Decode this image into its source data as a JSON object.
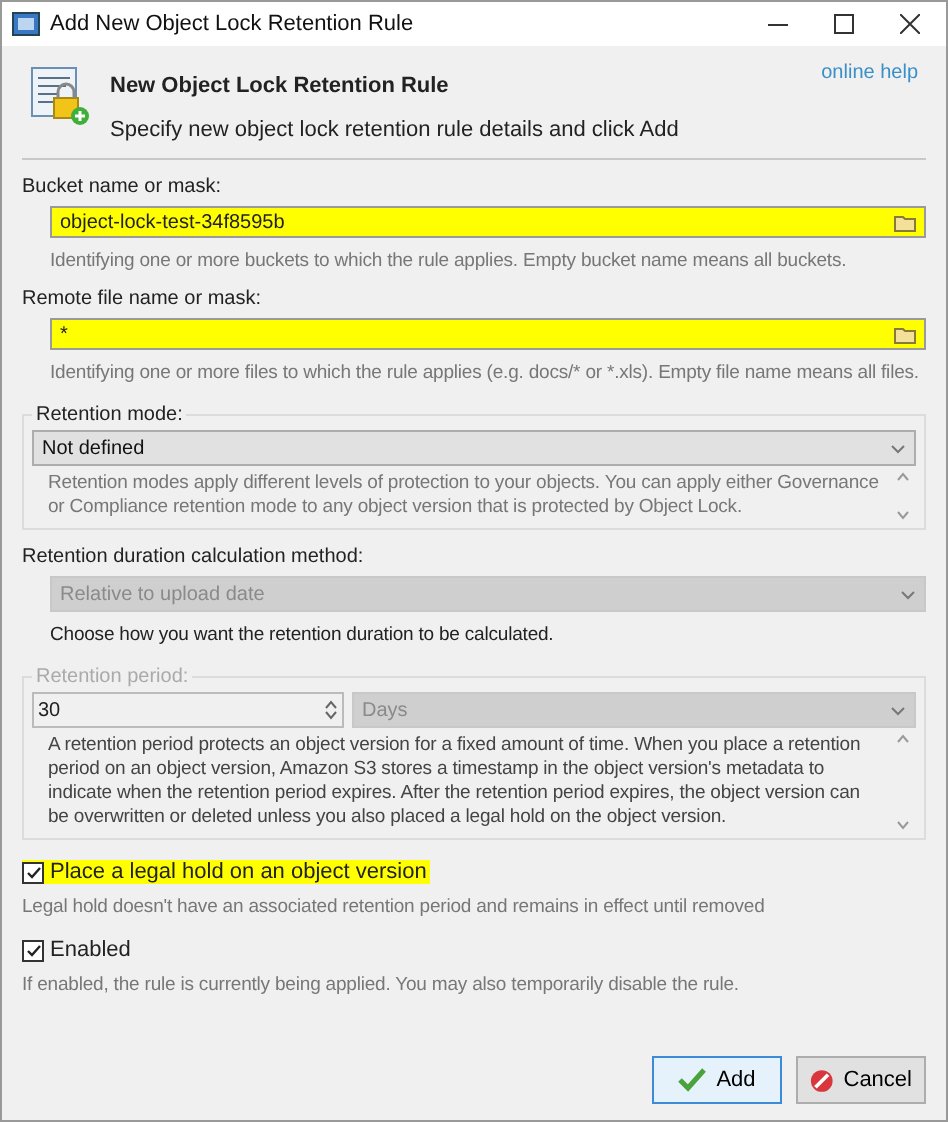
{
  "window": {
    "title": "Add New Object Lock Retention Rule"
  },
  "header": {
    "title": "New Object Lock Retention Rule",
    "subtitle": "Specify new object lock retention rule details and click Add",
    "help_link": "online help"
  },
  "bucket": {
    "label": "Bucket name or mask:",
    "value": "object-lock-test-34f8595b",
    "highlighted": true,
    "hint": "Identifying one or more buckets to which the rule applies. Empty bucket name means all buckets."
  },
  "file": {
    "label": "Remote file name or mask:",
    "value": "*",
    "highlighted": true,
    "hint": "Identifying one or more files to which the rule applies (e.g. docs/* or *.xls). Empty file name means all files."
  },
  "retention_mode": {
    "label": "Retention mode:",
    "value": "Not defined",
    "description": "Retention modes apply different levels of protection to your objects. You can apply either Governance or Compliance retention mode to any object version that is protected by Object Lock."
  },
  "calculation_method": {
    "label": "Retention duration calculation method:",
    "value": "Relative to upload date",
    "disabled": true,
    "hint": "Choose how you want the retention duration to be calculated."
  },
  "retention_period": {
    "label": "Retention period:",
    "disabled": true,
    "amount": "30",
    "unit": "Days",
    "description": "A retention period protects an object version for a fixed amount of time. When you place a retention period on an object version, Amazon S3 stores a timestamp in the object version's metadata to indicate when the retention period expires. After the retention period expires, the object version can be overwritten or deleted unless you also placed a legal hold on the object version."
  },
  "legal_hold": {
    "label": "Place a legal hold on an object version",
    "checked": true,
    "highlighted": true,
    "hint": "Legal hold doesn't have an associated retention period and remains in effect until removed"
  },
  "enabled": {
    "label": "Enabled",
    "checked": true,
    "highlighted": false,
    "hint": "If enabled, the rule is currently being applied. You may also temporarily disable the rule."
  },
  "buttons": [
    {
      "kind": "add",
      "label": "Add",
      "focused": true
    },
    {
      "kind": "cancel",
      "label": "Cancel",
      "focused": false
    }
  ]
}
